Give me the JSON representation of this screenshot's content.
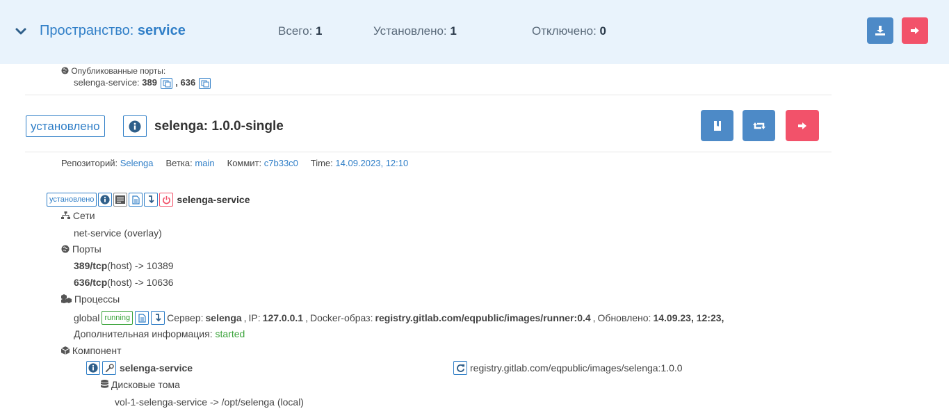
{
  "header": {
    "space_label": "Пространство:",
    "space_name": "service",
    "total_label": "Всего:",
    "total_value": "1",
    "installed_label": "Установлено:",
    "installed_value": "1",
    "disabled_label": "Отключено:",
    "disabled_value": "0"
  },
  "published_ports": {
    "title": "Опубликованные порты:",
    "service": "selenga-service:",
    "port1": "389",
    "sep": ",",
    "port2": "636"
  },
  "app": {
    "status": "установлено",
    "name": "selenga: 1.0.0-single"
  },
  "meta": {
    "repo_label": "Репозиторий:",
    "repo_value": "Selenga",
    "branch_label": "Ветка:",
    "branch_value": "main",
    "commit_label": "Коммит:",
    "commit_value": "c7b33c0",
    "time_label": "Time:",
    "time_value": "14.09.2023, 12:10"
  },
  "service": {
    "status": "установлено",
    "name": "selenga-service",
    "networks_title": "Сети",
    "network": "net-service (overlay)",
    "ports_title": "Порты",
    "ports": [
      {
        "port": "389/tcp",
        "rest": "(host) -> 10389"
      },
      {
        "port": "636/tcp",
        "rest": "(host) -> 10636"
      }
    ],
    "processes_title": "Процессы",
    "process": {
      "mode": "global",
      "state": "running",
      "server_label": "Сервер:",
      "server": "selenga",
      "ip_label": "IP:",
      "ip": "127.0.0.1",
      "image_label": "Docker-образ:",
      "image": "registry.gitlab.com/eqpublic/images/runner:0.4",
      "updated_label": "Обновлено:",
      "updated": "14.09.23, 12:23,",
      "extra_label": "Дополнительная информация:",
      "extra": "started"
    },
    "component_title": "Компонент",
    "component": {
      "name": "selenga-service",
      "image": "registry.gitlab.com/eqpublic/images/selenga:1.0.0",
      "volumes_title": "Дисковые тома",
      "volume": "vol-1-selenga-service -> /opt/selenga (local)"
    }
  },
  "colors": {
    "accent": "#2f7ec7",
    "header_bg": "#e9f3fc",
    "button_blue": "#4d8ac7",
    "button_red": "#f2526a",
    "green": "#3aa33a"
  }
}
